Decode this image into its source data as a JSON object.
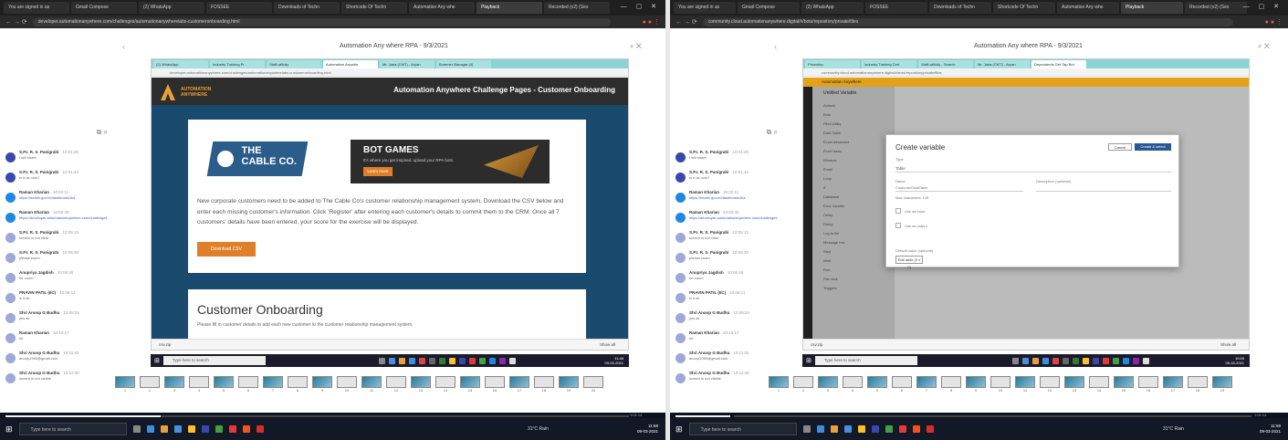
{
  "browser_tabs": [
    {
      "label": "You are signed in as",
      "active": false
    },
    {
      "label": "Gmail Compose",
      "active": false
    },
    {
      "label": "(2) WhatsApp",
      "active": false
    },
    {
      "label": "FOSSEE",
      "active": false
    },
    {
      "label": "Downloads of Techn",
      "active": false
    },
    {
      "label": "Shortcode Of Techn",
      "active": false
    },
    {
      "label": "Automation Any whe",
      "active": false
    },
    {
      "label": "Playback",
      "active": true
    },
    {
      "label": "Recorded (v2) (Ses",
      "active": false
    }
  ],
  "meeting_title": "Automation Any where RPA - 9/3/2021",
  "contacts": [
    {
      "name": "S.P.I. R. S. Panigrahi",
      "time": "10:01:20",
      "msg": "I will share",
      "color": "#3949ab",
      "link": false
    },
    {
      "name": "S.P.I. R. S. Panigrahi",
      "time": "10:01:44",
      "msg": "Is it ok now?",
      "color": "#3949ab",
      "link": false
    },
    {
      "name": "Raman Kharian",
      "time": "10:02:11",
      "msg": "https://health.gov.in/dashboard/Aut",
      "color": "#1e88e5",
      "link": true
    },
    {
      "name": "Raman Kharian",
      "time": "10:02:40",
      "msg": "https://developer.automationanywhere.com/challenges",
      "color": "#1e88e5",
      "link": true
    },
    {
      "name": "S.P.I. R. S. Panigrahi",
      "time": "10:05:12",
      "msg": "screen is not clear",
      "color": "#9fa8da",
      "link": false
    },
    {
      "name": "S.P.I. R. S. Panigrahi",
      "time": "10:05:30",
      "msg": "please zoom",
      "color": "#9fa8da",
      "link": false
    },
    {
      "name": "Anupriya Jagdish",
      "time": "10:06:48",
      "msg": "for zoom",
      "color": "#9fa8da",
      "link": false
    },
    {
      "name": "PRAVIN PATIL (IIC)",
      "time": "10:08:11",
      "msg": "is it ok",
      "color": "#9fa8da",
      "link": false
    },
    {
      "name": "Shri Anoop G Budhu",
      "time": "10:09:04",
      "msg": "yes sir",
      "color": "#9fa8da",
      "link": false
    },
    {
      "name": "Raman Kharian",
      "time": "10:10:17",
      "msg": "sir",
      "color": "#9fa8da",
      "link": false
    },
    {
      "name": "Shri Anoop G Budhu",
      "time": "10:11:02",
      "msg": "anoop1990@gmail.com",
      "color": "#9fa8da",
      "link": false
    },
    {
      "name": "Shri Anoop G Budhu",
      "time": "10:12:30",
      "msg": "screen is not visible",
      "color": "#9fa8da",
      "link": false
    }
  ],
  "left": {
    "inner_tabs": [
      {
        "label": "(2) WhatsApp",
        "active": false
      },
      {
        "label": "Industry Training Pr",
        "active": false
      },
      {
        "label": "Staff-wilfully",
        "active": false
      },
      {
        "label": "Automation Anywhe",
        "active": true
      },
      {
        "label": "Mr. Jaba (CMT) - Aryan",
        "active": false
      },
      {
        "label": "Bommer Banagar (4)",
        "active": false
      }
    ],
    "url": "developer.automationanywhere.com/challenges/automationanywherelabs-customeronboarding.html",
    "logo_line1": "AUTOMATION",
    "logo_line2": "ANYWHERE",
    "page_title": "Automation Anywhere Challenge Pages - Customer Onboarding",
    "cable_logo_line1": "THE",
    "cable_logo_line2": "CABLE CO.",
    "botgames_title": "BOT GAMES",
    "botgames_sub": "It's where you get inspired. upload your RPA bots.",
    "botgames_btn": "Learn more",
    "description": "New corporate customers need to be added to The Cable Co's customer relationship management system. Download the CSV below and enter each missing customer's information. Click 'Register' after entering each customer's details to commit them to the CRM. Once all 7 customers' details have been entered, your score for the exercise will be displayed.",
    "download_btn": "Download CSV",
    "section_title": "Customer Onboarding",
    "section_desc": "Please fill in customer details to add each new customer to the customer relationship management system.",
    "download_file": "csv.zip",
    "show_all": "Show all",
    "search_placeholder": "Type here to search",
    "clock": [
      "11:48",
      "09-03-2021"
    ],
    "thumb_numbers": [
      "1",
      "2",
      "3",
      "4",
      "5",
      "6",
      "7",
      "8",
      "9",
      "10",
      "11",
      "12",
      "13",
      "14",
      "15",
      "16",
      "17",
      "18",
      "19",
      "20"
    ],
    "seek_time_left": "0:12:22",
    "seek_time_right": "1:01:14"
  },
  "right": {
    "inner_tabs": [
      {
        "label": "Pricestep",
        "active": false
      },
      {
        "label": "Industry Training Cert",
        "active": false
      },
      {
        "label": "Staff-wilfully - Search",
        "active": false
      },
      {
        "label": "Mr. Jaba (CMT) - Aryan",
        "active": false
      },
      {
        "label": "Dependents Get Tap Bot",
        "active": true
      }
    ],
    "url": "community.cloud.automationanywhere.digital/#/bots/repository/private/files",
    "app_bar": "Automation Anywhere",
    "panel_title": "Untitled Variable",
    "panel_items": [
      "Actions",
      "Bots",
      "Files Utility",
      "Data Table",
      "Excel advanced",
      "Excel basic",
      "Window",
      "Email",
      "Loop",
      "If",
      "Database",
      "Error handler",
      "Delay",
      "String",
      "Log to file",
      "Message box",
      "Step",
      "Wait",
      "Run",
      "Run task",
      "Triggers"
    ],
    "modal_title": "Create variable",
    "cancel": "Cancel",
    "create": "Create & select",
    "type_label": "Type",
    "type_value": "Table",
    "name_label": "Name",
    "name_value": "CustomerDataTable",
    "default_label": "Default value (optional)",
    "max_chars": "Max characters: 128",
    "desc_label": "Description (optional)",
    "use_as_input": "Use as input",
    "use_as_output": "Use as output",
    "edit_table": "Edit table (0 x 0)",
    "download_file": "csv.zip",
    "show_all": "Show all",
    "search_placeholder": "Type here to search",
    "clock": [
      "10:55",
      "09-03-2021"
    ],
    "thumb_numbers": [
      "1",
      "2",
      "3",
      "4",
      "5",
      "6",
      "7",
      "8",
      "9",
      "10",
      "11",
      "12",
      "13",
      "14",
      "15",
      "16",
      "17",
      "18",
      "19"
    ],
    "seek_time_left": "0:13:22",
    "seek_time_right": "1:01:14"
  },
  "outer": {
    "search_placeholder": "Type here to search",
    "clock": [
      "11:58",
      "09-03-2021"
    ],
    "weather": "31°C Rain"
  }
}
